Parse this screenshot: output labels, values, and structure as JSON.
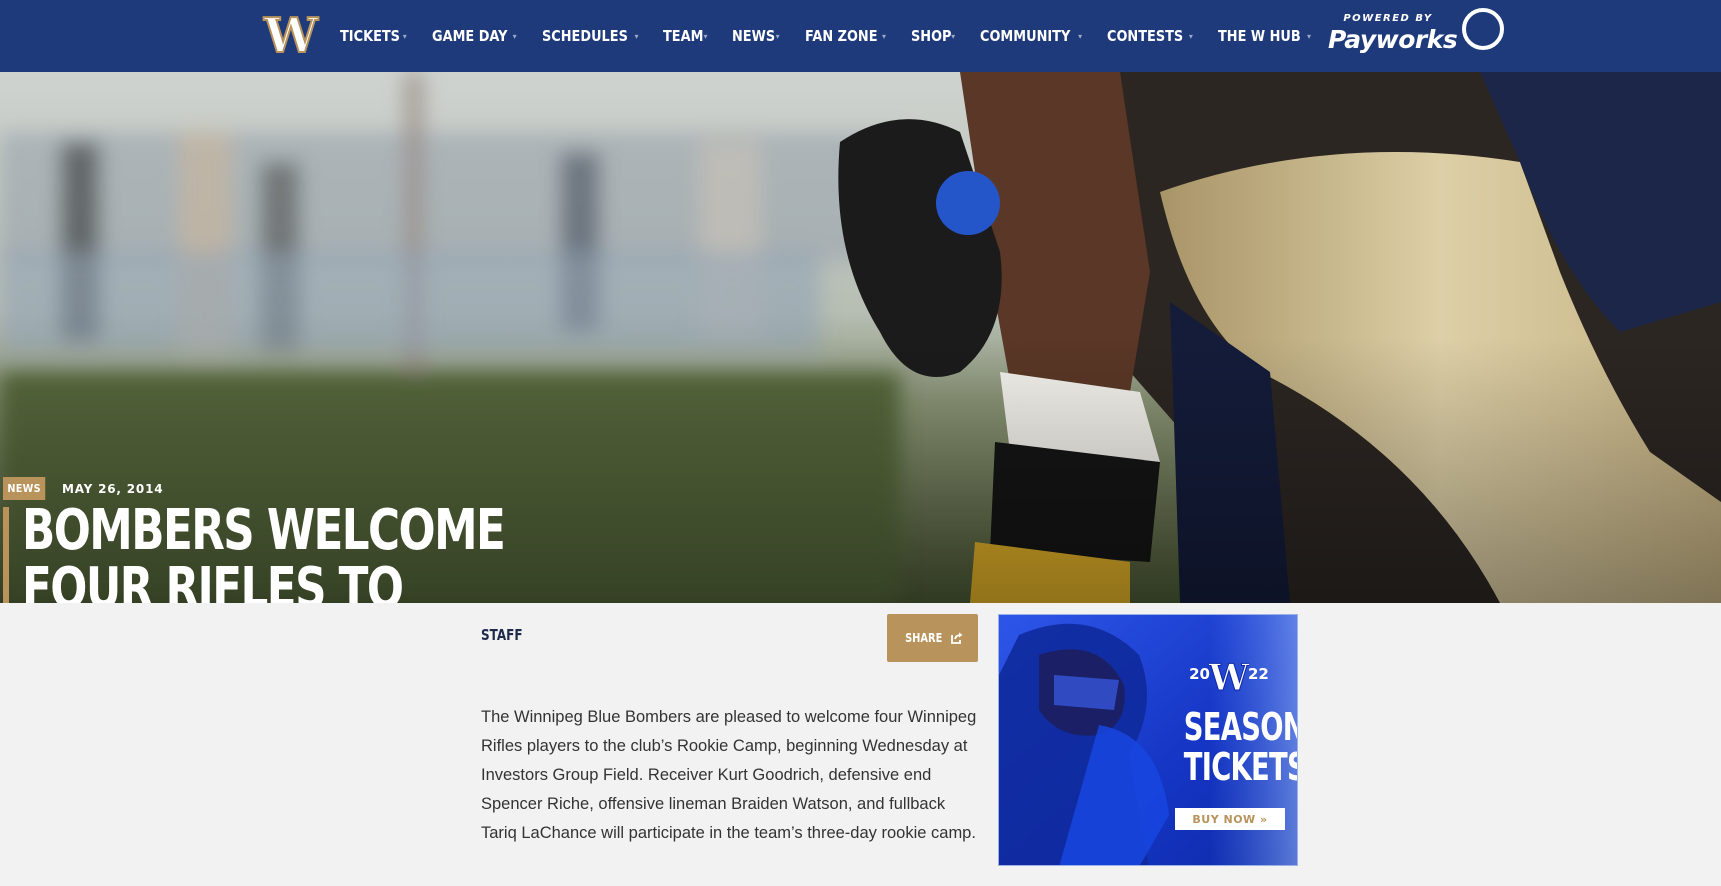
{
  "nav": {
    "logo_letter": "W",
    "items": [
      {
        "label": "TICKETS"
      },
      {
        "label": "GAME DAY"
      },
      {
        "label": "SCHEDULES"
      },
      {
        "label": "TEAM"
      },
      {
        "label": "NEWS"
      },
      {
        "label": "FAN ZONE"
      },
      {
        "label": "SHOP"
      },
      {
        "label": "COMMUNITY"
      },
      {
        "label": "CONTESTS"
      },
      {
        "label": "THE W HUB"
      }
    ],
    "caret": "▾",
    "powered_by": "POWERED BY",
    "sponsor": "Payworks"
  },
  "hero": {
    "tag": "NEWS",
    "date": "MAY 26, 2014",
    "title": "BOMBERS WELCOME FOUR RIFLES TO ROOKIE CAMP"
  },
  "article": {
    "author": "STAFF",
    "share_label": "SHARE",
    "body": "The Winnipeg Blue Bombers are pleased to welcome four Winnipeg Rifles players to the club’s Rookie Camp, beginning Wednesday at Investors Group Field. Receiver Kurt Goodrich, defensive end Spencer Riche, offensive lineman Braiden Watson, and fullback Tariq LaChance will participate in the team’s three-day rookie camp."
  },
  "ad": {
    "year_left": "20",
    "year_right": "22",
    "logo_letter": "W",
    "title_line1": "SEASON",
    "title_line2": "TICKETS",
    "cta": "BUY NOW »"
  },
  "colors": {
    "navy": "#1e3a7a",
    "gold": "#b8935b",
    "ad_blue": "#1b3fd6"
  }
}
